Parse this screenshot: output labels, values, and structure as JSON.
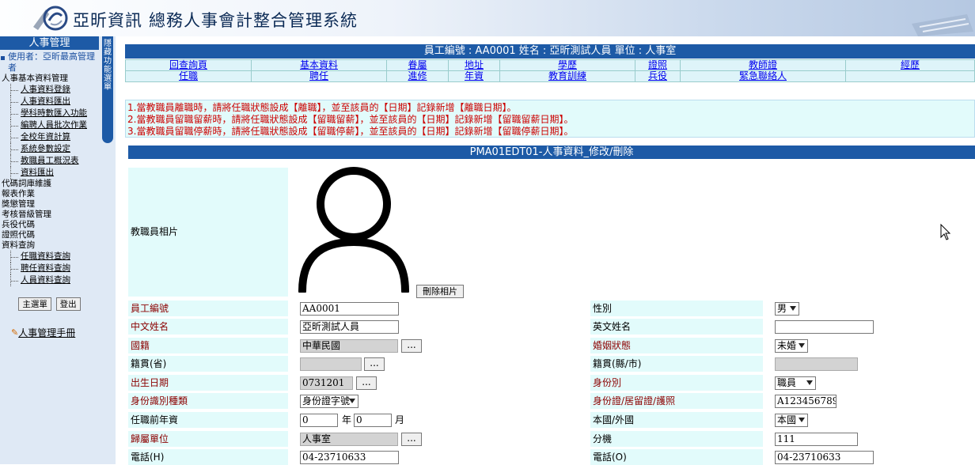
{
  "banner": {
    "company": "亞昕資訊",
    "system_name": "總務人事會計整合管理系統"
  },
  "sidebar": {
    "title": "人事管理",
    "user_label": "使用者：亞昕最高管理者",
    "menu": [
      {
        "label": "人事基本資料管理",
        "level": 1
      },
      {
        "label": "人事資料登錄",
        "level": 2
      },
      {
        "label": "人事資料匯出",
        "level": 2
      },
      {
        "label": "學科時數匯入功能",
        "level": 2
      },
      {
        "label": "編聘人員批次作業",
        "level": 2
      },
      {
        "label": "全校年資計算",
        "level": 2
      },
      {
        "label": "系統參數設定",
        "level": 2
      },
      {
        "label": "教職員工概況表",
        "level": 2
      },
      {
        "label": "資料匯出",
        "level": 2
      },
      {
        "label": "代碼詞庫維護",
        "level": 1
      },
      {
        "label": "報表作業",
        "level": 1
      },
      {
        "label": "獎懲管理",
        "level": 1
      },
      {
        "label": "考核晉級管理",
        "level": 1
      },
      {
        "label": "兵役代碼",
        "level": 1
      },
      {
        "label": "證照代碼",
        "level": 1
      },
      {
        "label": "資料查詢",
        "level": 1
      },
      {
        "label": "任職資料查詢",
        "level": 2
      },
      {
        "label": "聘任資料查詢",
        "level": 2
      },
      {
        "label": "人員資料查詢",
        "level": 2
      }
    ],
    "main_menu_btn": "主選單",
    "logout_btn": "登出",
    "manual_link": "人事管理手冊"
  },
  "hide_tab": [
    "隱",
    "藏",
    "功",
    "能",
    "選",
    "單"
  ],
  "employee_header": "員工編號 : AA0001 姓名 : 亞昕測試人員 單位 : 人事室",
  "nav_row1": [
    "回查詢頁",
    "基本資料",
    "眷屬",
    "地址",
    "學歷",
    "證照",
    "教師證",
    "經歷"
  ],
  "nav_row2": [
    "任職",
    "聘任",
    "進修",
    "年資",
    "教育訓練",
    "兵役",
    "緊急聯絡人",
    ""
  ],
  "notices": [
    "1.當教職員離職時，請將任職狀態設成【離職】，並至該員的【日期】記錄新增【離職日期】。",
    "2.當教職員留職留薪時，請將任職狀態設成【留職留薪】，並至該員的【日期】記錄新增【留職留薪日期】。",
    "3.當教職員留職停薪時，請將任職狀態設成【留職停薪】，並至該員的【日期】記錄新增【留職停薪日期】。"
  ],
  "form": {
    "title": "PMA01EDT01-人事資料_修改/刪除",
    "photo_label": "教職員相片",
    "delete_photo_btn": "刪除相片",
    "browse_btn": "...",
    "emp_no_label": "員工編號",
    "emp_no": "AA0001",
    "gender_label": "性別",
    "gender": "男",
    "cname_label": "中文姓名",
    "cname": "亞昕測試人員",
    "ename_label": "英文姓名",
    "ename": "",
    "nationality_label": "國籍",
    "nationality": "中華民國",
    "marital_label": "婚姻狀態",
    "marital": "未婚",
    "origin_prov_label": "籍貫(省)",
    "origin_prov": "",
    "origin_city_label": "籍貫(縣/市)",
    "origin_city": "",
    "birth_label": "出生日期",
    "birth": "0731201",
    "identity_label": "身份別",
    "identity": "職員",
    "id_type_label": "身份識別種類",
    "id_type": "身份證字號",
    "id_no_label": "身份證/居留證/護照",
    "id_no": "A123456789",
    "prior_years_label": "任職前年資",
    "prior_years": "0",
    "year_unit": "年",
    "prior_months": "0",
    "month_unit": "月",
    "domestic_label": "本國/外國",
    "domestic": "本國",
    "unit_label": "歸屬單位",
    "unit": "人事室",
    "ext_label": "分機",
    "ext": "111",
    "phone_h_label": "電話(H)",
    "phone_h": "04-23710633",
    "phone_o_label": "電話(O)",
    "phone_o": "04-23710633"
  },
  "colors": {
    "header_blue": "#1d5aa6",
    "label_cyan": "#e2fbfb",
    "notice_red": "#cc0000"
  }
}
